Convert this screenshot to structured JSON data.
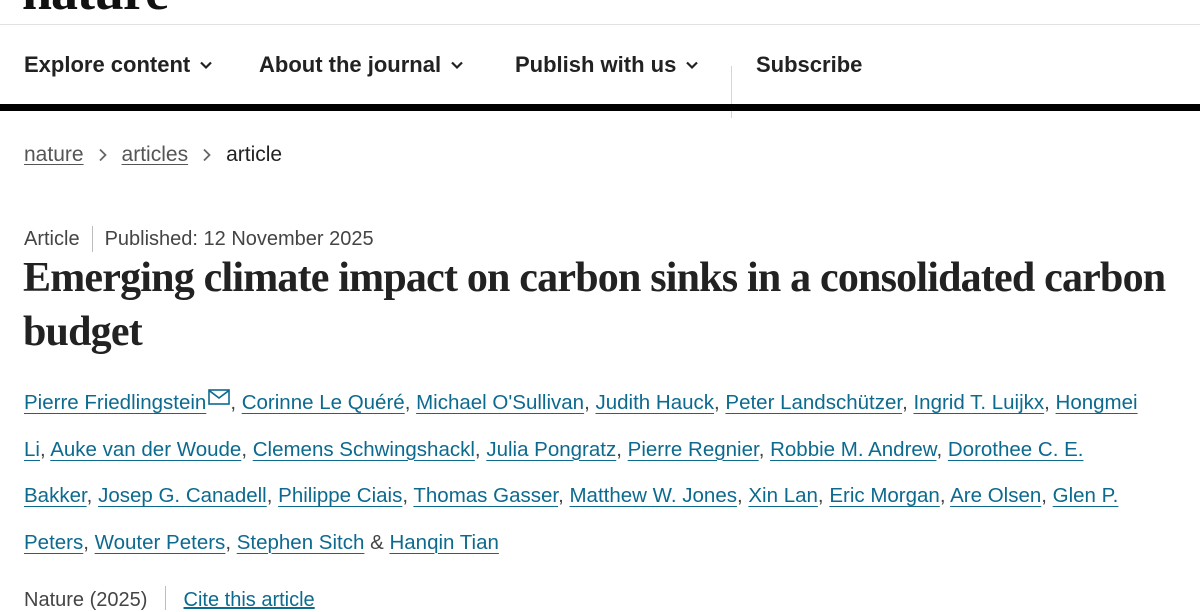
{
  "logo": {
    "text": "nature"
  },
  "nav": {
    "items": [
      {
        "label": "Explore content",
        "dropdown": true
      },
      {
        "label": "About the journal",
        "dropdown": true
      },
      {
        "label": "Publish with us",
        "dropdown": true
      },
      {
        "label": "Subscribe",
        "dropdown": false
      }
    ]
  },
  "breadcrumb": {
    "items": [
      "nature",
      "articles"
    ],
    "current": "article"
  },
  "article": {
    "type": "Article",
    "published": "Published: 12 November 2025",
    "title": "Emerging climate impact on carbon sinks in a consolidated carbon budget",
    "authors": [
      "Pierre Friedlingstein",
      "Corinne Le Quéré",
      "Michael O'Sullivan",
      "Judith Hauck",
      "Peter Landschützer",
      "Ingrid T. Luijkx",
      "Hongmei Li",
      "Auke van der Woude",
      "Clemens Schwingshackl",
      "Julia Pongratz",
      "Pierre Regnier",
      "Robbie M. Andrew",
      "Dorothee C. E. Bakker",
      "Josep G. Canadell",
      "Philippe Ciais",
      "Thomas Gasser",
      "Matthew W. Jones",
      "Xin Lan",
      "Eric Morgan",
      "Are Olsen",
      "Glen P. Peters",
      "Wouter Peters",
      "Stephen Sitch",
      "Hanqin Tian"
    ],
    "final_separator": "&",
    "journal_line": "Nature (2025)",
    "cite_label": "Cite this article"
  },
  "colors": {
    "link": "#0c6a8f",
    "nav_bar": "#000000"
  },
  "icons": {
    "dropdown": "chevron-down-icon",
    "breadcrumb_separator": "chevron-right-icon",
    "email": "envelope-icon"
  }
}
